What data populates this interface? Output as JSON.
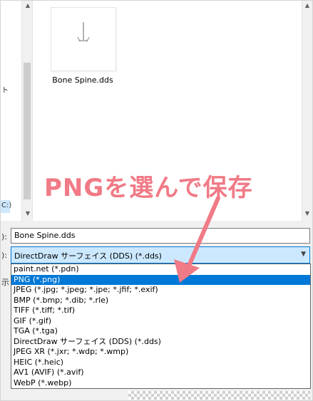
{
  "left_nav": {
    "fragment_top": "ト",
    "fragment_drive": "C:)"
  },
  "file": {
    "name": "Bone Spine.dds",
    "thumb_icon": "bone-spine-image"
  },
  "annotation": {
    "text": "PNGを選んで保存",
    "color": "#f07a86",
    "arrow_color": "#f07a86"
  },
  "form": {
    "name_label_fragment": "):",
    "name_value": "Bone Spine.dds",
    "type_label_fragment": "):",
    "type_value": "DirectDraw サーフェイス (DDS) (*.dds)",
    "bottom_fragment": "示"
  },
  "dropdown": {
    "options": [
      "paint.net (*.pdn)",
      "PNG (*.png)",
      "JPEG (*.jpg; *.jpeg; *.jpe; *.jfif; *.exif)",
      "BMP (*.bmp; *.dib; *.rle)",
      "TIFF (*.tiff; *.tif)",
      "GIF (*.gif)",
      "TGA (*.tga)",
      "DirectDraw サーフェイス (DDS) (*.dds)",
      "JPEG XR (*.jxr; *.wdp; *.wmp)",
      "HEIC (*.heic)",
      "AV1 (AVIF) (*.avif)",
      "WebP (*.webp)"
    ],
    "selected_index": 1
  },
  "colors": {
    "selection_blue": "#0078d7",
    "selection_light": "#cce8ff"
  }
}
